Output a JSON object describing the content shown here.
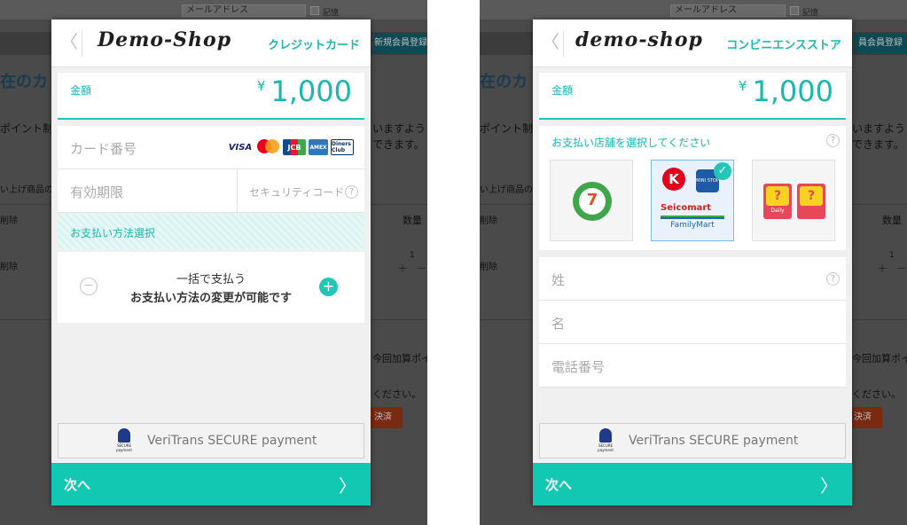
{
  "background": {
    "email_field": "メールアドレス",
    "remember_label": "記憶",
    "register_button": "新規会員登録",
    "register_button_short": "員会員登録",
    "heading": "在のカ",
    "heading_right": "在のカ",
    "text_point": "ポイント制",
    "text_point_right": "ポイント制",
    "text_request_1": "いますよう",
    "text_request_2": "できます。",
    "text_goods": "い上げ商品の",
    "col_delete": "削除",
    "col_qty": "数量",
    "qty_value": "1",
    "plus": "＋",
    "minus": "－",
    "text_points_added": "今回加算ポイ",
    "text_please": "ください。",
    "checkout_button": "決済"
  },
  "credit_modal": {
    "back": "〈",
    "shop_name": "Demo-Shop",
    "method": "クレジットカード",
    "amount_label": "金額",
    "currency": "¥",
    "amount": "1,000",
    "card_number_label": "カード番号",
    "brands": {
      "visa": "VISA",
      "jcb": "JCB",
      "amex": "AMEX",
      "diners": "Diners Club"
    },
    "expiry_label": "有効期限",
    "security_label": "セキュリティコード",
    "help": "?",
    "payment_select_label": "お支払い方法選択",
    "payment_option_line1": "一括で支払う",
    "payment_option_line2": "お支払い方法の変更が可能です",
    "minus": "−",
    "plus": "+",
    "secure_text": "VeriTrans SECURE payment",
    "secure_logo_text": "SECURE payment",
    "next_label": "次へ",
    "next_arrow": "〉"
  },
  "cvs_modal": {
    "back": "〈",
    "shop_name": "demo-shop",
    "method": "コンビニエンスストア",
    "amount_label": "金額",
    "currency": "¥",
    "amount": "1,000",
    "store_select_label": "お支払い店舗を選択してください",
    "help": "?",
    "stores": {
      "seven": "7",
      "circlek": "K",
      "ministop": "MINI STOP",
      "seicomart": "Seicomart",
      "familymart": "FamilyMart",
      "daily_mark": "?",
      "daily_label": "Daily"
    },
    "check": "✓",
    "last_name_label": "姓",
    "first_name_label": "名",
    "phone_label": "電話番号",
    "secure_text": "VeriTrans SECURE payment",
    "secure_logo_text": "SECURE payment",
    "next_label": "次へ",
    "next_arrow": "〉"
  },
  "colors": {
    "accent": "#12c8b3",
    "accent_text": "#17b8b0",
    "modal_bg": "#f0f0f0"
  }
}
